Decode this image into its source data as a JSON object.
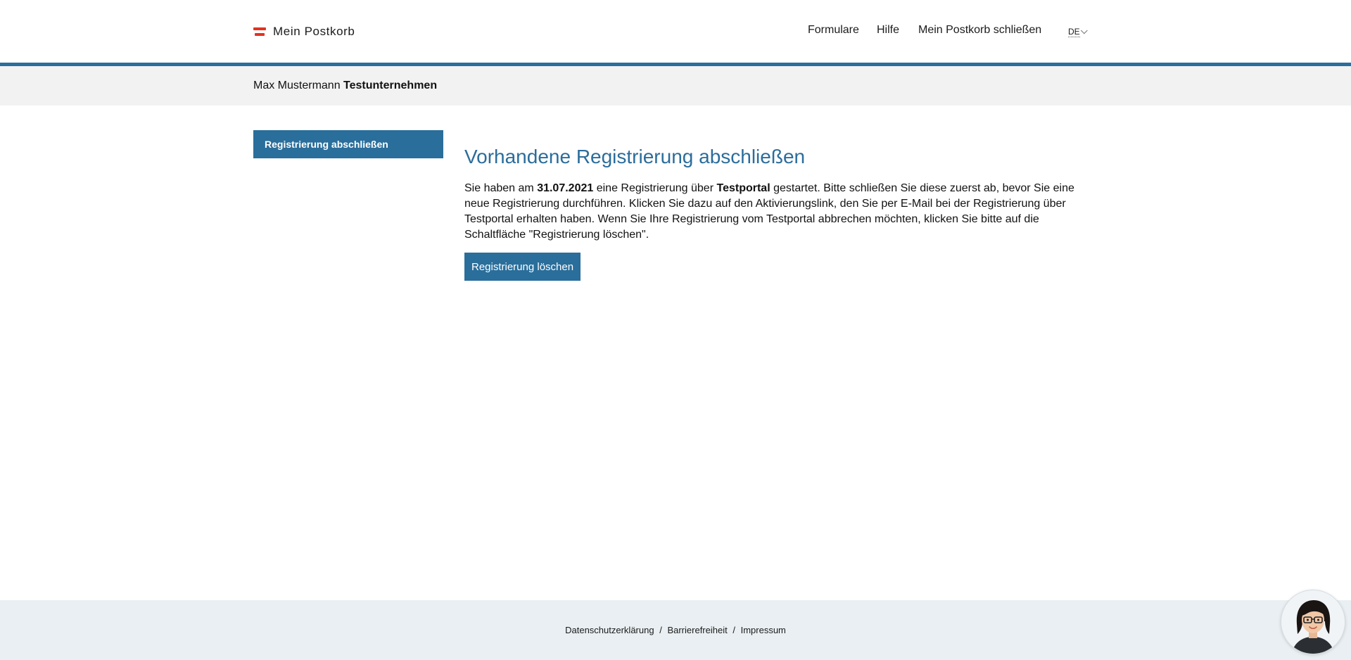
{
  "header": {
    "brand_title": "Mein Postkorb",
    "nav": [
      {
        "label": "Formulare"
      },
      {
        "label": "Hilfe"
      },
      {
        "label": "Mein Postkorb schließen"
      }
    ],
    "language": "DE"
  },
  "identity": {
    "person": "Max Mustermann",
    "company": "Testunternehmen"
  },
  "sidebar": {
    "items": [
      {
        "label": "Registrierung abschließen"
      }
    ]
  },
  "main": {
    "title": "Vorhandene Registrierung abschließen",
    "text_1": "Sie haben am ",
    "date": "31.07.2021",
    "text_2": " eine Registrierung über ",
    "portal": "Testportal",
    "text_3": " gestartet. Bitte schließen Sie diese zuerst ab, bevor Sie eine neue Registrierung durchführen. Klicken Sie dazu auf den Aktivierungslink, den Sie per E-Mail bei der Registrierung über Testportal erhalten haben. Wenn Sie Ihre Registrierung vom Testportal abbrechen möchten, klicken Sie bitte auf die Schaltfläche \"Registrierung löschen\".",
    "delete_button_label": "Registrierung löschen"
  },
  "footer": {
    "links": [
      {
        "label": "Datenschutzerklärung"
      },
      {
        "label": "Barrierefreiheit"
      },
      {
        "label": "Impressum"
      }
    ],
    "separator": "/"
  },
  "colors": {
    "accent": "#2b6d9b",
    "flag_red": "#e2321f",
    "identity_bar": "#f2f2f2",
    "footer_bg": "#e9eff2"
  },
  "icons": {
    "brand": "austria-flag-icon",
    "language": "chevron-down-icon",
    "assistant": "assistant-avatar-icon"
  }
}
